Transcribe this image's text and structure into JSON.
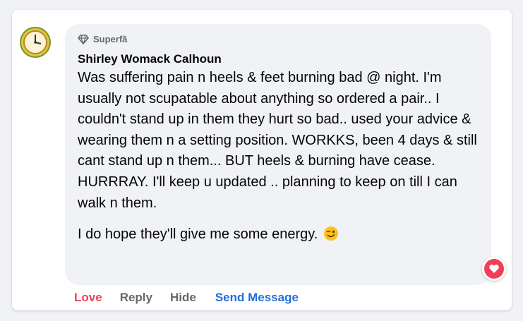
{
  "comment": {
    "badge_label": "Superfã",
    "badge_icon": "diamond-icon",
    "author": "Shirley Womack Calhoun",
    "paragraph_1": "Was suffering pain n heels & feet burning bad @ night. I'm usually not scupatable about anything so ordered a pair.. I couldn't stand up in them they hurt so bad.. used your advice & wearing them n a setting position. WORKKS, been 4 days & still cant stand up n them... BUT heels & burning have cease. HURRRAY. I'll keep u updated .. planning to keep on till I can walk n them.",
    "paragraph_2": "I do hope they'll give me some energy.",
    "emoji": "winking-face-icon",
    "reaction": "love-reaction-icon"
  },
  "actions": {
    "love": "Love",
    "reply": "Reply",
    "hide": "Hide",
    "send_message": "Send Message"
  },
  "colors": {
    "love": "#f33e58",
    "link": "#216fdb",
    "muted": "#65676b",
    "bubble": "#f0f2f5"
  }
}
